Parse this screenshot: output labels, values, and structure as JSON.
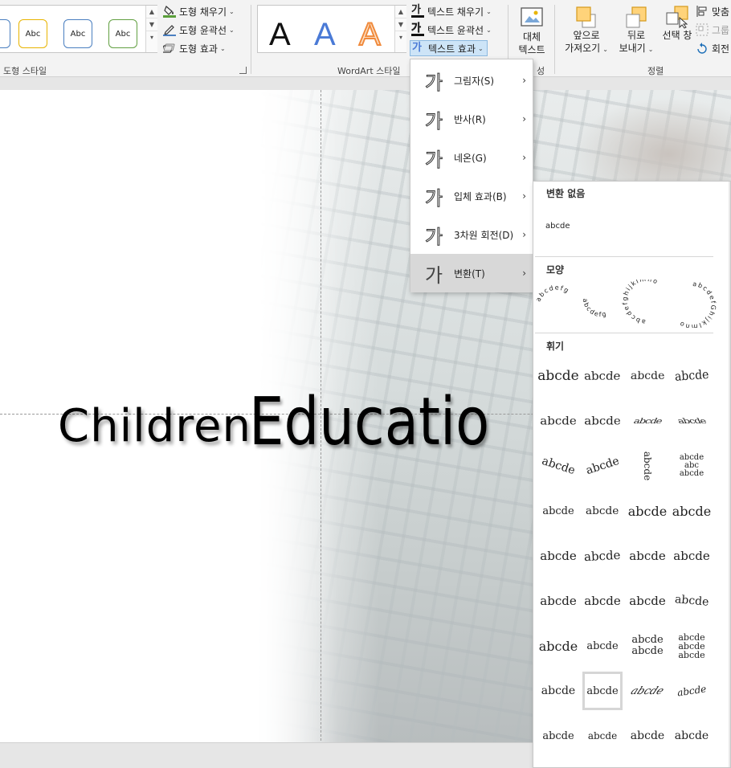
{
  "ribbon": {
    "shape_styles": {
      "thumb_label": "Abc",
      "thumbs": [
        {
          "border": "#e8b400"
        },
        {
          "border": "#4a7fc0"
        },
        {
          "border": "#62a042"
        }
      ],
      "fill_label": "도형 채우기",
      "outline_label": "도형 윤곽선",
      "effect_label": "도형 효과",
      "group_label": "도형 스타일"
    },
    "wordart": {
      "letter": "A",
      "letter_colors": [
        "#111111",
        "#4a7ad6",
        "#f0a060"
      ],
      "text_fill_label": "텍스트 채우기",
      "text_outline_label": "텍스트 윤곽선",
      "text_effect_label": "텍스트 효과",
      "group_label": "WordArt 스타일",
      "glyph": "가"
    },
    "accessibility": {
      "alt_text_line1": "대체",
      "alt_text_line2": "텍스트",
      "group_label_fragment": "성"
    },
    "arrange": {
      "bring_forward_line1": "앞으로",
      "bring_forward_line2": "가져오기",
      "send_backward_line1": "뒤로",
      "send_backward_line2": "보내기",
      "selection_pane_label": "선택 창",
      "align_label": "맞춤",
      "group_label_btn": "그룹",
      "rotate_label": "회전",
      "group_label": "정렬"
    }
  },
  "slide": {
    "title_part1": "Children",
    "title_part2": "Educatio"
  },
  "text_effect_menu": {
    "glyph": "가",
    "items": [
      {
        "label": "그림자(S)"
      },
      {
        "label": "반사(R)"
      },
      {
        "label": "네온(G)"
      },
      {
        "label": "입체 효과(B)"
      },
      {
        "label": "3차원 회전(D)"
      },
      {
        "label": "변환(T)"
      }
    ],
    "active_index": 5,
    "arrow": "›"
  },
  "transform_submenu": {
    "no_transform_header": "변환 없음",
    "no_transform_sample": "abcde",
    "shape_header": "모양",
    "shape_samples": [
      "abcdefg",
      "abcdefg",
      "abcdefghijklmno",
      "abcdefGhijklmno"
    ],
    "warp_header": "휘기",
    "warp_sample": "abcde",
    "warp_rows": 9,
    "warp_cols": 4,
    "selected_cell": {
      "row": 7,
      "col": 1
    }
  }
}
